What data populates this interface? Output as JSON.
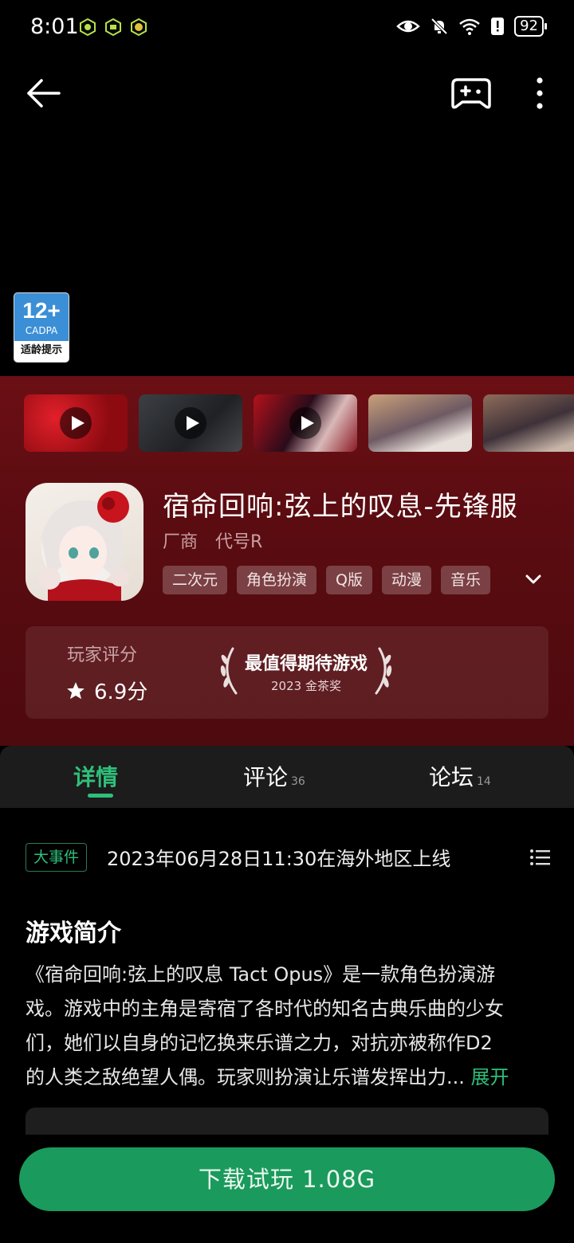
{
  "status_bar": {
    "time": "8:01",
    "battery": "92"
  },
  "rating_badge": {
    "age": "12+",
    "org": "CADPA",
    "note": "适龄提示"
  },
  "app": {
    "title": "宿命回响:弦上的叹息-先锋服",
    "developer_label": "厂商",
    "developer": "代号R",
    "tags": [
      "二次元",
      "角色扮演",
      "Q版",
      "动漫",
      "音乐"
    ]
  },
  "score": {
    "label": "玩家评分",
    "value": "6.9分",
    "award_title": "最值得期待游戏",
    "award_sub": "2023 金茶奖"
  },
  "tabs": [
    {
      "label": "详情",
      "count": ""
    },
    {
      "label": "评论",
      "count": "36"
    },
    {
      "label": "论坛",
      "count": "14"
    }
  ],
  "event": {
    "badge": "大事件",
    "text": "2023年06月28日11:30在海外地区上线"
  },
  "intro": {
    "heading": "游戏简介",
    "lines": [
      "《宿命回响:弦上的叹息 Tact Opus》是一款角色扮演游",
      "戏。游戏中的主角是寄宿了各时代的知名古典乐曲的少女",
      "们，她们以自身的记忆换来乐谱之力，对抗亦被称作D2",
      "的人类之敌绝望人偶。玩家则扮演让乐谱发挥出力..."
    ],
    "expand": "展开"
  },
  "download": {
    "label": "下载试玩 1.08G"
  },
  "colors": {
    "accent_green": "#2fbf7a",
    "button_green": "#1a9a5c",
    "panel_red": "#5a0c11"
  }
}
